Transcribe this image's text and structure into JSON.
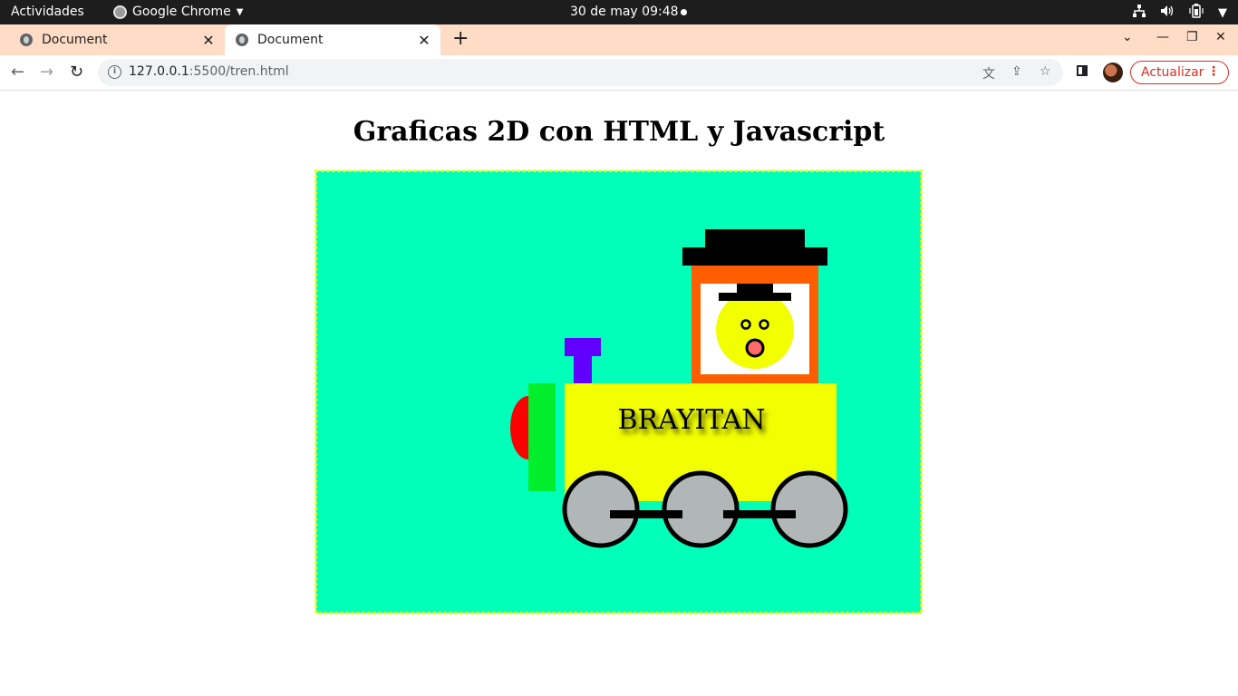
{
  "system_bar": {
    "activities": "Actividades",
    "app_name": "Google Chrome",
    "clock": "30 de may  09:48",
    "tray_icons": [
      "network-icon",
      "volume-icon",
      "battery-icon"
    ]
  },
  "browser": {
    "tabs": [
      {
        "title": "Document",
        "active": false
      },
      {
        "title": "Document",
        "active": true
      }
    ],
    "url_host": "127.0.0.1",
    "url_rest": ":5500/tren.html",
    "update_label": "Actualizar"
  },
  "page": {
    "heading": "Graficas 2D con HTML y Javascript",
    "canvas": {
      "train_name": "BRAYITAN",
      "colors": {
        "background": "#00ffb9",
        "border": "#f2ff00",
        "body": "#f2ff00",
        "cab": "#ff5e00",
        "window": "#ffffff",
        "hat": "#000000",
        "face": "#f2ff00",
        "mouth": "#ff6b6b",
        "chimney": "#6200ff",
        "front_bumper": "#00ee2c",
        "lamp": "#ff0000",
        "wheels": "#b1b6b6",
        "axle": "#000000"
      }
    }
  }
}
